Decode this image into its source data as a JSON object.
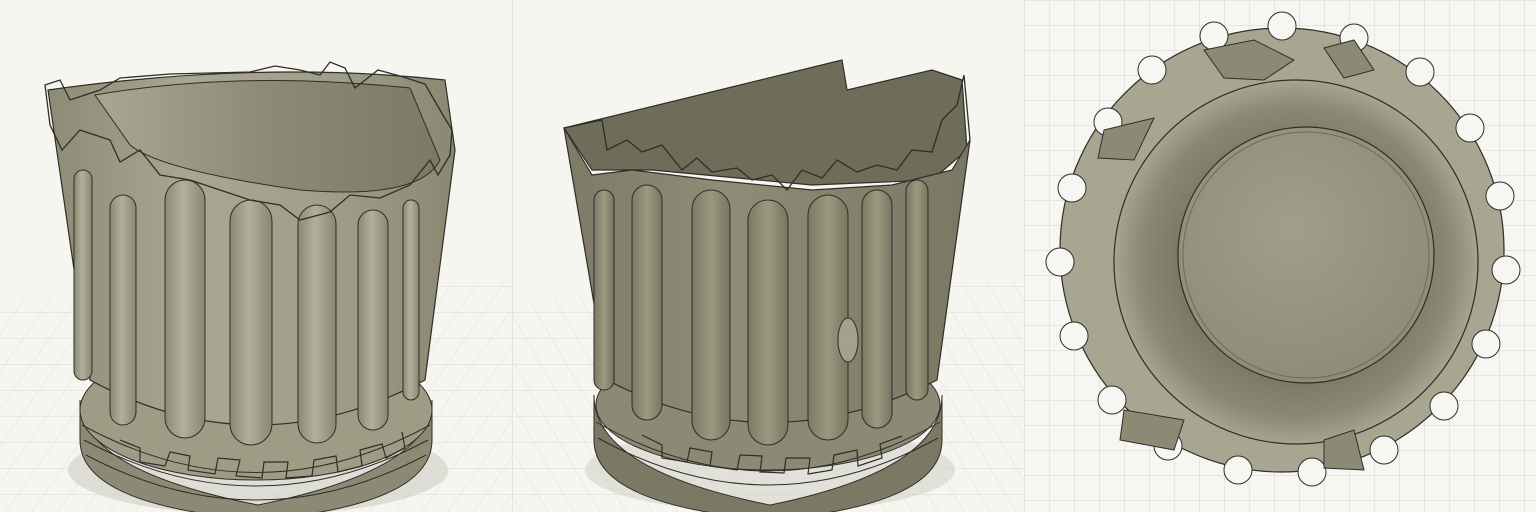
{
  "scene": {
    "subject": "fluted-column-pot-3d-render",
    "views": [
      {
        "id": "front-perspective",
        "icon": "fluted-pot-front-view"
      },
      {
        "id": "angled-perspective",
        "icon": "fluted-pot-angled-view"
      },
      {
        "id": "top-down",
        "icon": "fluted-pot-top-view"
      }
    ]
  },
  "colors": {
    "background": "#f6f6f1",
    "grid": "#d4d4d0",
    "model_light": "#a8a591",
    "model_mid": "#9a977f",
    "model_dark": "#7f7c68",
    "model_shadow": "#6f6c5a",
    "edge": "#2f2e28"
  }
}
